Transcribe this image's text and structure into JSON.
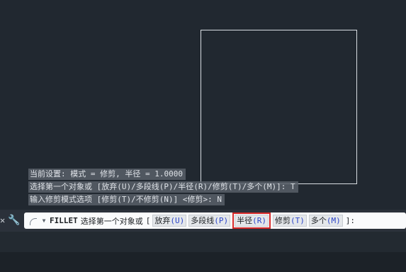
{
  "history": [
    "当前设置: 模式 = 修剪, 半径 = 1.0000",
    "选择第一个对象或 [放弃(U)/多段线(P)/半径(R)/修剪(T)/多个(M)]: T",
    "输入修剪模式选项 [修剪(T)/不修剪(N)] <修剪>: N"
  ],
  "command_line": {
    "close_glyph": "✕",
    "wrench_glyph": "🔧",
    "command": "FILLET",
    "prompt": "选择第一个对象或",
    "open_bracket": "[",
    "options": [
      {
        "label": "放弃",
        "key": "(U)"
      },
      {
        "label": "多段线",
        "key": "(P)"
      },
      {
        "label": "半径",
        "key": "(R)"
      },
      {
        "label": "修剪",
        "key": "(T)"
      },
      {
        "label": "多个",
        "key": "(M)"
      }
    ],
    "close_bracket": "]:",
    "highlight_color": "#d82a2a",
    "key_color": "#2c45c9"
  },
  "icons": {
    "wrench": "wrench-icon",
    "prompt": "command-prompt-icon",
    "dropdown": "chevron-down-icon"
  }
}
